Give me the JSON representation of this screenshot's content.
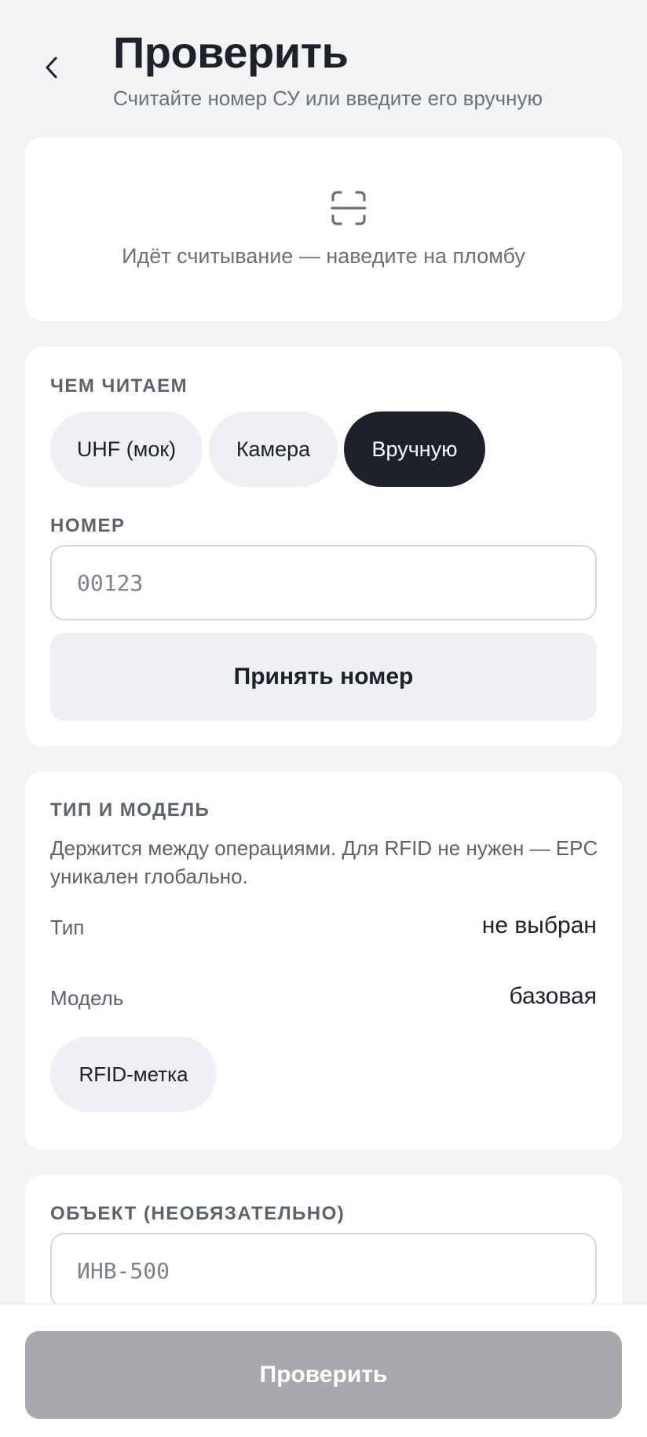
{
  "header": {
    "title": "Проверить",
    "subtitle": "Считайте номер СУ или введите его вручную",
    "back_icon": "chevron-left-icon"
  },
  "scan": {
    "icon": "scan-icon",
    "status_text": "Идёт считывание — наведите на пломбу"
  },
  "reader": {
    "section_label": "ЧЕМ ЧИТАЕМ",
    "options": [
      {
        "label": "UHF (мок)",
        "selected": false
      },
      {
        "label": "Камера",
        "selected": false
      },
      {
        "label": "Вручную",
        "selected": true
      }
    ],
    "number_label": "НОМЕР",
    "number_placeholder": "00123",
    "accept_label": "Принять номер"
  },
  "type_model": {
    "section_label": "ТИП И МОДЕЛЬ",
    "description": "Держится между операциями. Для RFID не нужен — EPC уникален глобально.",
    "type_label": "Тип",
    "type_value": "не выбран",
    "model_label": "Модель",
    "model_value": "базовая",
    "rfid_chip": "RFID-метка"
  },
  "object": {
    "section_label": "ОБЪЕКТ (НЕОБЯЗАТЕЛЬНО)",
    "placeholder": "ИНВ-500"
  },
  "footer": {
    "check_label": "Проверить"
  },
  "colors": {
    "background": "#f2f3f5",
    "card": "#ffffff",
    "chip": "#eef0f3",
    "chip_active": "#1d2129",
    "disabled_button": "#a7a9ad"
  }
}
